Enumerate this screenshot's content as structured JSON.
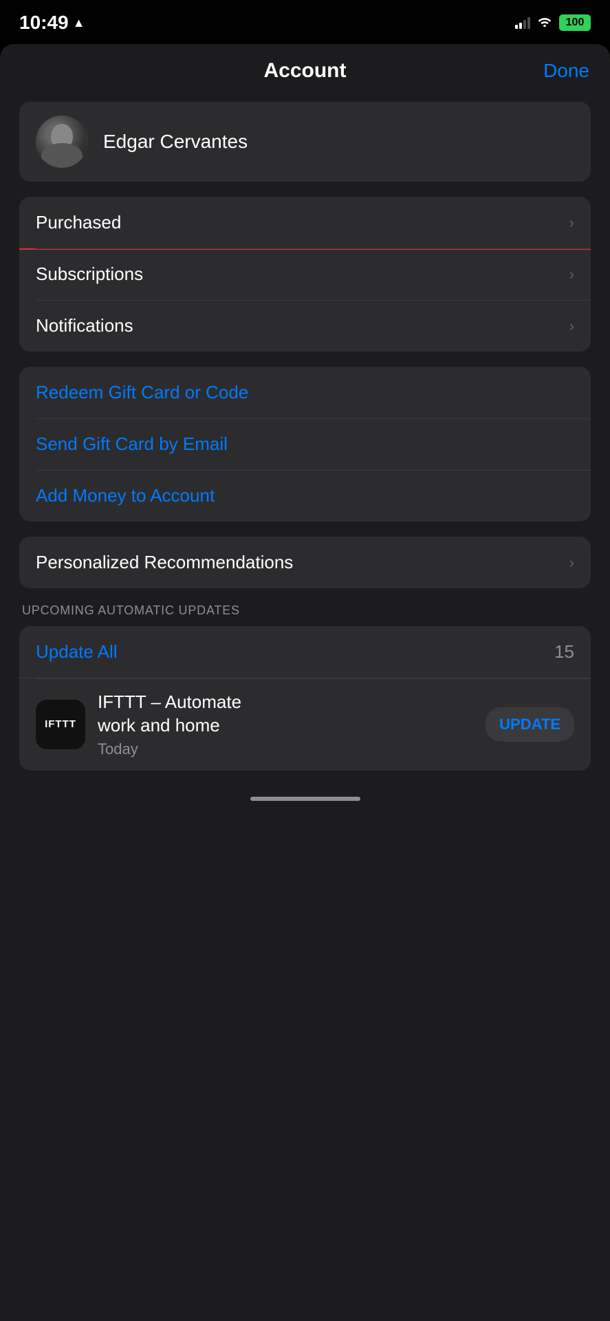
{
  "statusBar": {
    "time": "10:49",
    "battery": "100"
  },
  "nav": {
    "title": "Account",
    "done": "Done"
  },
  "user": {
    "name": "Edgar Cervantes"
  },
  "menuItems": [
    {
      "label": "Purchased",
      "highlighted": true
    },
    {
      "label": "Subscriptions",
      "highlighted": false
    },
    {
      "label": "Notifications",
      "highlighted": false
    }
  ],
  "giftCardLinks": [
    {
      "label": "Redeem Gift Card or Code"
    },
    {
      "label": "Send Gift Card by Email"
    },
    {
      "label": "Add Money to Account"
    }
  ],
  "recommendations": {
    "label": "Personalized Recommendations"
  },
  "updates": {
    "sectionTitle": "UPCOMING AUTOMATIC UPDATES",
    "updateAllLabel": "Update All",
    "updateCount": "15",
    "app": {
      "name": "IFTTT – Automate\nwork and home",
      "date": "Today",
      "logoText": "IFTTT",
      "updateBtn": "UPDATE"
    }
  }
}
